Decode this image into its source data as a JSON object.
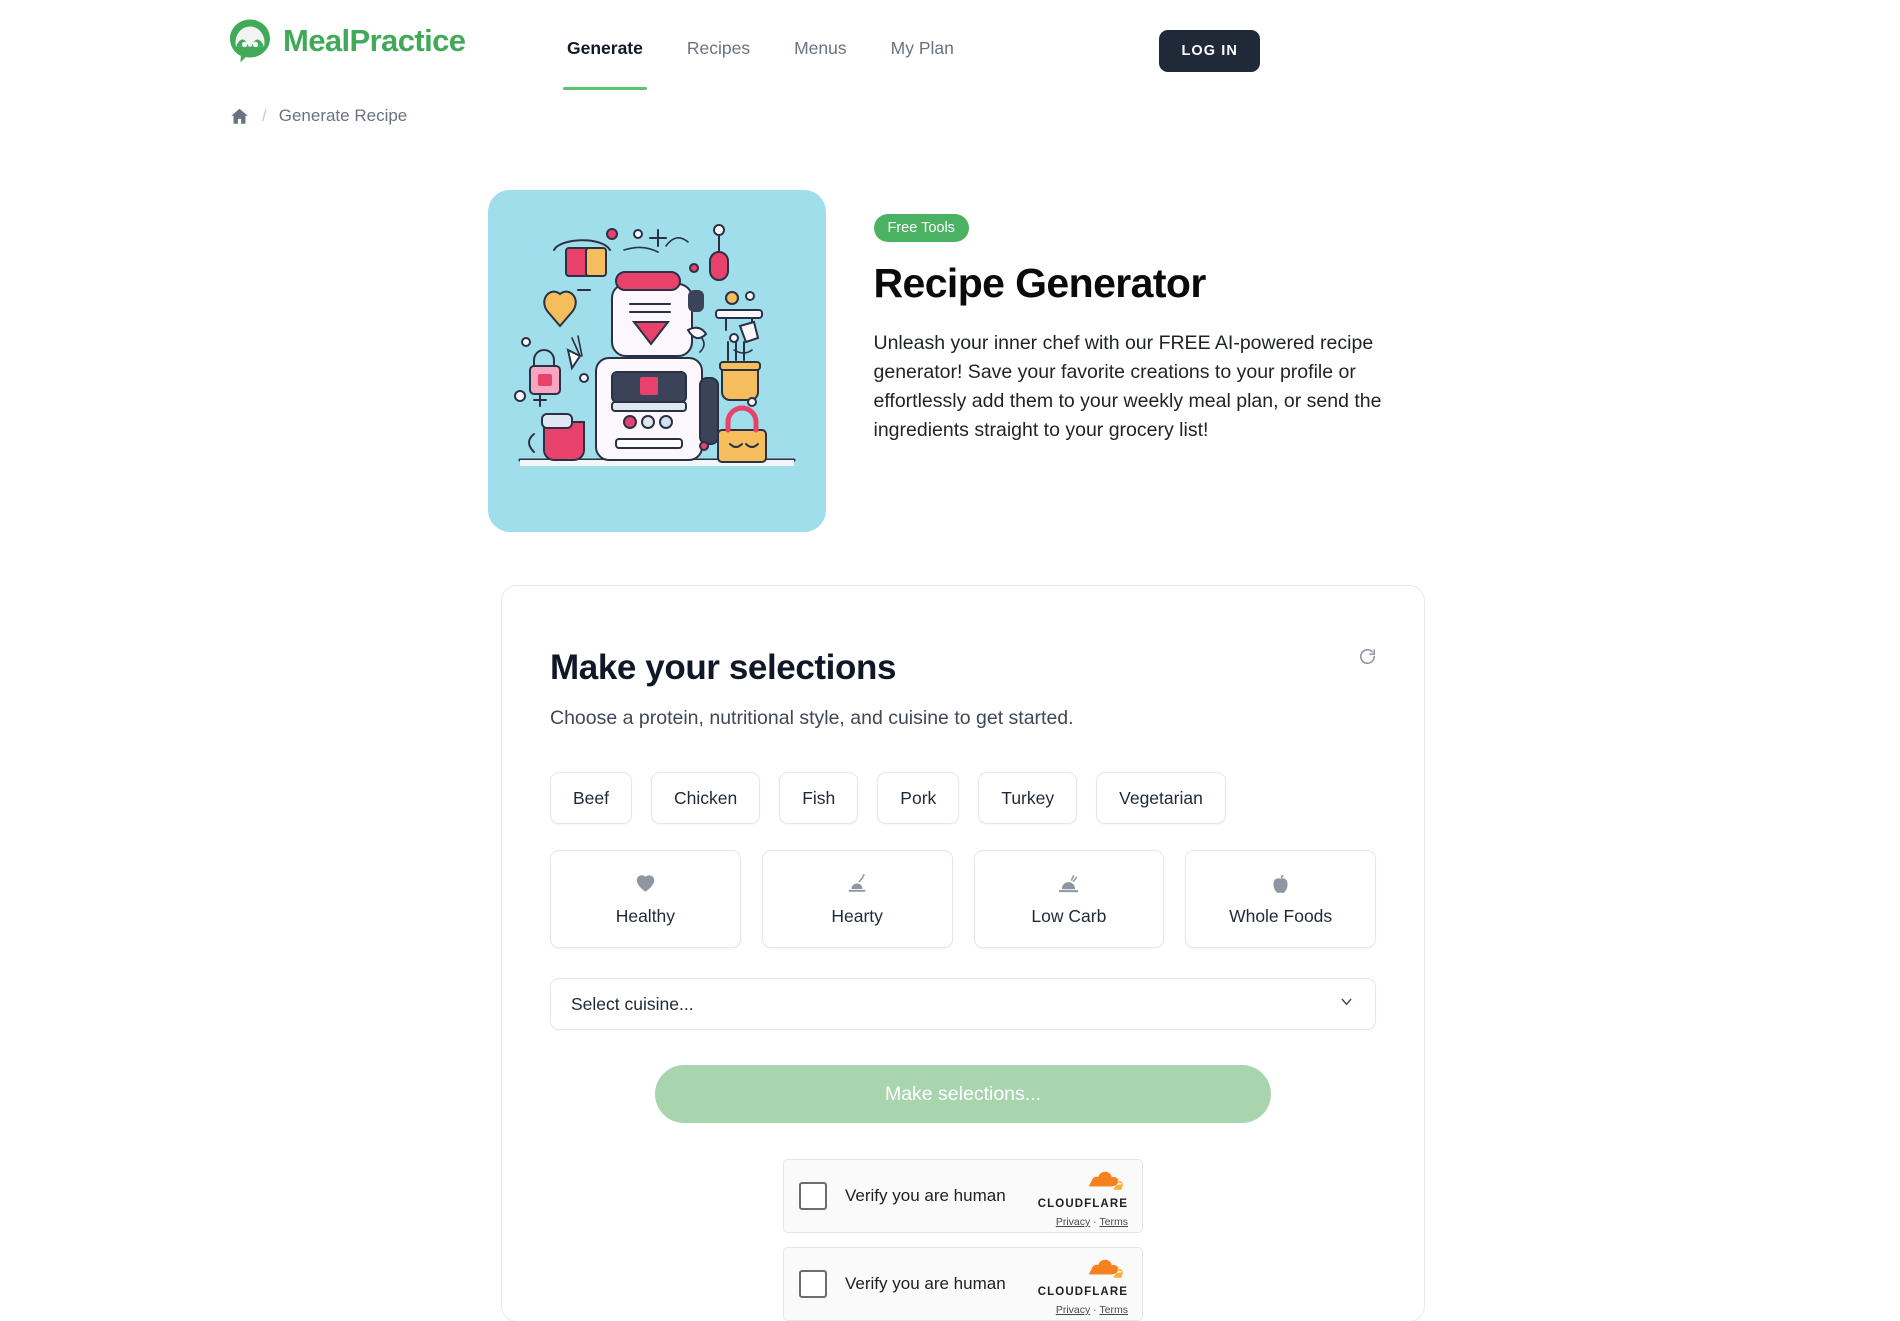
{
  "brand": {
    "name": "MealPractice",
    "color": "#41aa58",
    "logo_icon": "speech-bubble-mountain-logo"
  },
  "nav": {
    "items": [
      {
        "label": "Generate",
        "active": true
      },
      {
        "label": "Recipes",
        "active": false
      },
      {
        "label": "Menus",
        "active": false
      },
      {
        "label": "My Plan",
        "active": false
      }
    ],
    "login_label": "LOG IN"
  },
  "breadcrumb": {
    "home_icon": "home-icon",
    "separator": "/",
    "current": "Generate Recipe"
  },
  "hero": {
    "image_alt": "kitchen-appliance-illustration",
    "badge": "Free Tools",
    "title": "Recipe Generator",
    "description": "Unleash your inner chef with our FREE AI-powered recipe generator! Save your favorite creations to your profile or effortlessly add them to your weekly meal plan, or send the ingredients straight to your grocery list!"
  },
  "selections": {
    "title": "Make your selections",
    "subtitle": "Choose a protein, nutritional style, and cuisine to get started.",
    "refresh_icon": "refresh-icon",
    "proteins": [
      "Beef",
      "Chicken",
      "Fish",
      "Pork",
      "Turkey",
      "Vegetarian"
    ],
    "styles": [
      {
        "label": "Healthy",
        "icon": "heart-icon"
      },
      {
        "label": "Hearty",
        "icon": "carving-meat-icon"
      },
      {
        "label": "Low Carb",
        "icon": "roast-turkey-icon"
      },
      {
        "label": "Whole Foods",
        "icon": "apple-icon"
      }
    ],
    "cuisine_placeholder": "Select cuisine...",
    "cuisine_value": "",
    "chevron_icon": "chevron-down-icon",
    "submit_label": "Make selections..."
  },
  "turnstile": [
    {
      "label": "Verify you are human",
      "brand": "CLOUDFLARE",
      "privacy": "Privacy",
      "dot": "·",
      "terms": "Terms",
      "checked": false
    },
    {
      "label": "Verify you are human",
      "brand": "CLOUDFLARE",
      "privacy": "Privacy",
      "dot": "·",
      "terms": "Terms",
      "checked": false
    }
  ],
  "colors": {
    "accent_green": "#4cb263",
    "nav_underline": "#5ac46f",
    "login_bg": "#1f2937",
    "hero_bg": "#9fdeea",
    "cloudflare_orange": "#f6821f"
  }
}
